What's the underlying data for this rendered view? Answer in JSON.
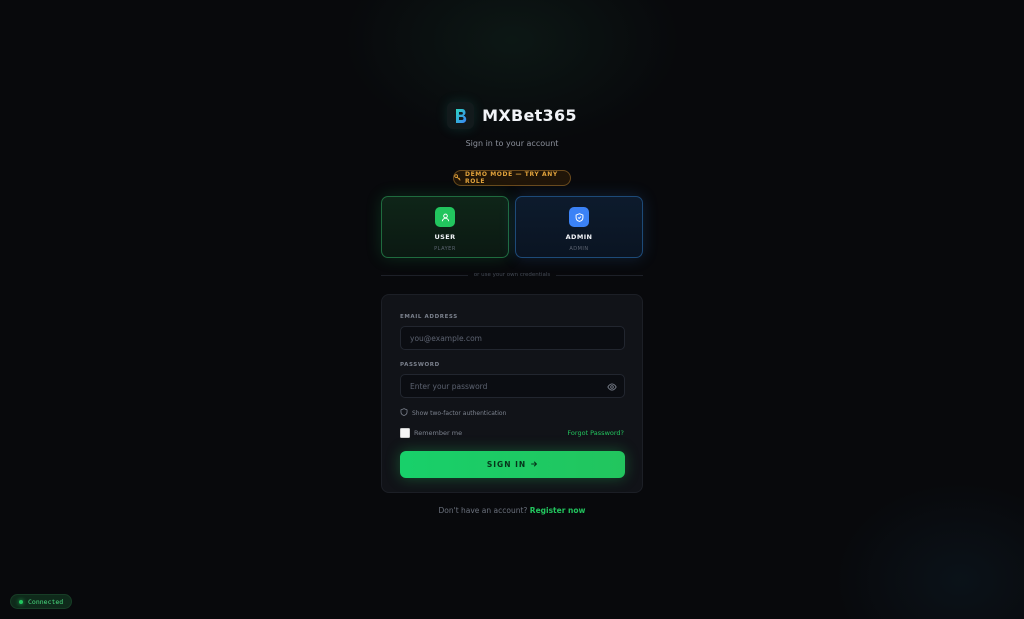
{
  "brand": {
    "name": "MXBet365",
    "logo_icon": "b-logo-icon"
  },
  "subtitle": "Sign in to your account",
  "demo_badge": {
    "icon": "key-icon",
    "label": "DEMO MODE — TRY ANY ROLE"
  },
  "roles": [
    {
      "title": "USER",
      "subtitle": "PLAYER",
      "icon": "user-icon",
      "color": "#22c55e"
    },
    {
      "title": "ADMIN",
      "subtitle": "ADMIN",
      "icon": "shield-icon",
      "color": "#3b82f6"
    }
  ],
  "divider_text": "or use your own credentials",
  "form": {
    "email_label": "EMAIL ADDRESS",
    "email_placeholder": "you@example.com",
    "password_label": "PASSWORD",
    "password_placeholder": "Enter your password",
    "twofa_label": "Show two-factor authentication",
    "remember_label": "Remember me",
    "forgot_label": "Forgot Password?",
    "submit_label": "SIGN IN"
  },
  "register": {
    "prompt": "Don't have an account?",
    "link": "Register now"
  },
  "status": {
    "label": "Connected",
    "color": "#22c55e"
  }
}
